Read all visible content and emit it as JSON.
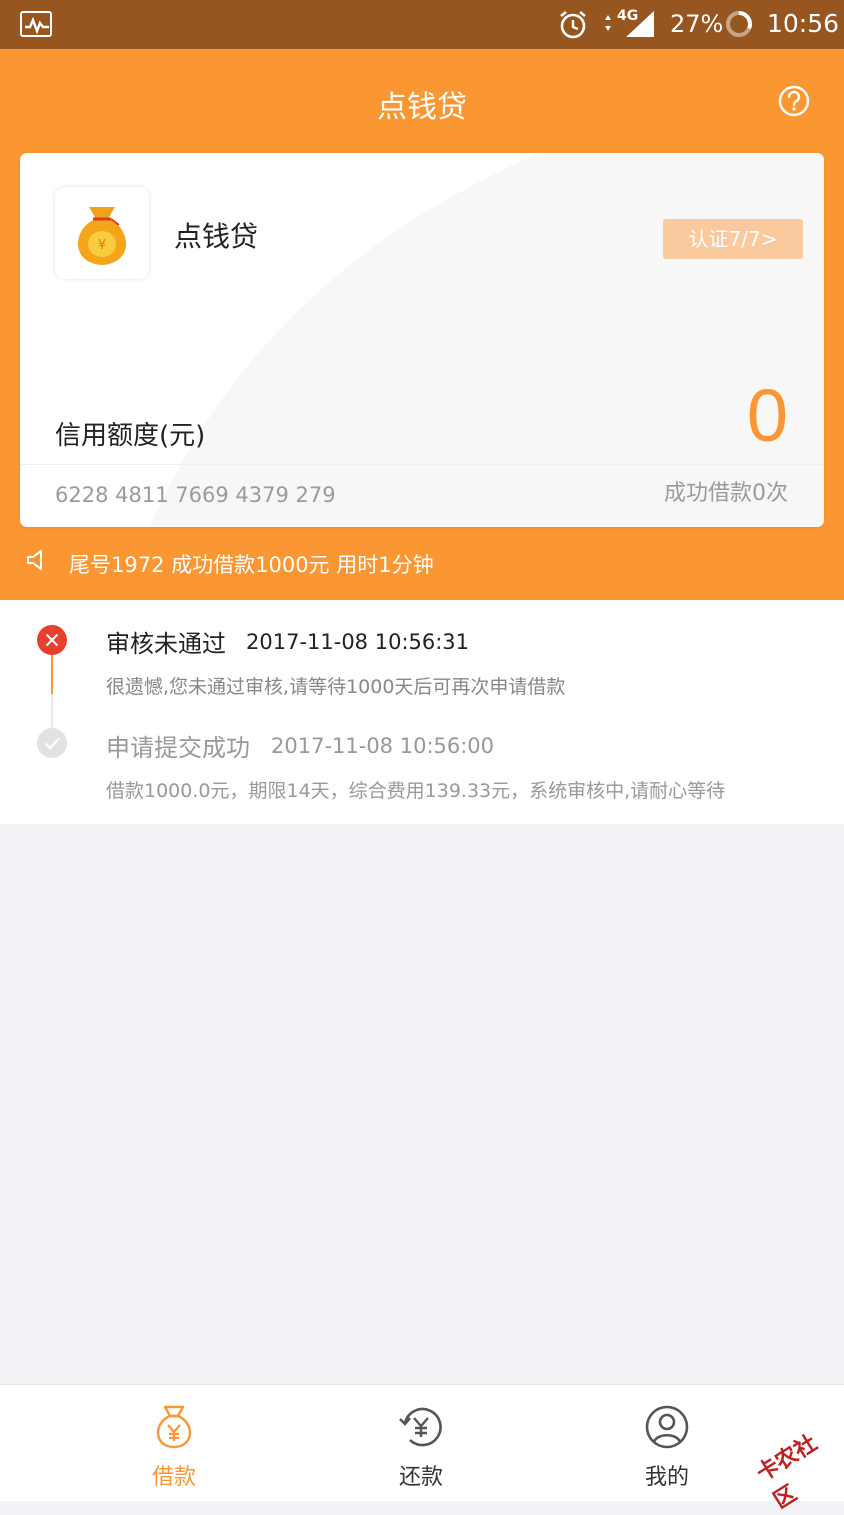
{
  "status_bar": {
    "network": "4G",
    "battery": "27%",
    "time": "10:56"
  },
  "header": {
    "title": "点钱贷"
  },
  "card": {
    "brand": "点钱贷",
    "cert_button": "认证7/7>",
    "credit_label": "信用额度(元)",
    "credit_value": "0",
    "card_number": "6228 4811 7669 4379 279",
    "loan_count": "成功借款0次"
  },
  "notice": {
    "text": "尾号1972 成功借款1000元 用时1分钟"
  },
  "timeline": [
    {
      "status": "fail",
      "title": "审核未通过",
      "time": "2017-11-08 10:56:31",
      "desc": "很遗憾,您未通过审核,请等待1000天后可再次申请借款"
    },
    {
      "status": "done",
      "title": "申请提交成功",
      "time": "2017-11-08 10:56:00",
      "desc": "借款1000.0元，期限14天，综合费用139.33元，系统审核中,请耐心等待"
    }
  ],
  "bottom_nav": {
    "borrow": "借款",
    "repay": "还款",
    "mine": "我的"
  },
  "watermark": {
    "text": "卡农社区"
  },
  "colors": {
    "accent": "#fb9732",
    "status_bar": "#975520",
    "fail": "#e8402f"
  },
  "icons": {
    "status_app": "activity-icon",
    "alarm": "alarm-icon",
    "help": "help-circle-icon",
    "notice": "speaker-icon",
    "borrow": "money-bag-icon",
    "repay": "yen-refresh-icon",
    "mine": "user-circle-icon"
  }
}
